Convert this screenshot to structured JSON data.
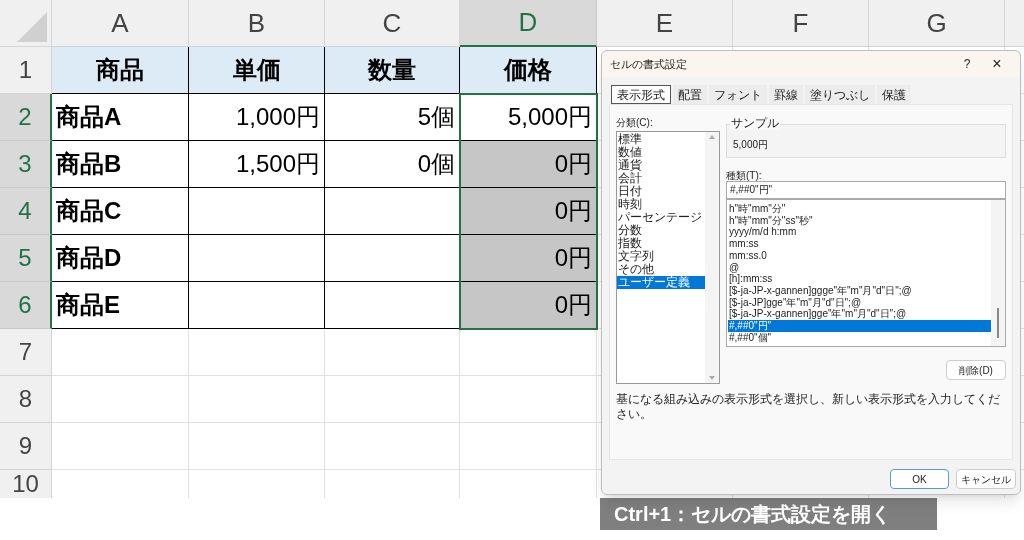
{
  "sheet": {
    "columns": [
      {
        "label": "A",
        "selected": false
      },
      {
        "label": "B",
        "selected": false
      },
      {
        "label": "C",
        "selected": false
      },
      {
        "label": "D",
        "selected": true
      },
      {
        "label": "E",
        "selected": false
      },
      {
        "label": "F",
        "selected": false
      },
      {
        "label": "G",
        "selected": false
      }
    ],
    "rows": [
      {
        "number": "1",
        "selected": false,
        "cells": [
          {
            "kind": "header",
            "text": "商品",
            "selected": false
          },
          {
            "kind": "header",
            "text": "単価",
            "selected": false
          },
          {
            "kind": "header",
            "text": "数量",
            "selected": false
          },
          {
            "kind": "header",
            "text": "価格",
            "selected": false
          }
        ]
      },
      {
        "number": "2",
        "selected": true,
        "cells": [
          {
            "kind": "name",
            "text": "商品A",
            "selected": false
          },
          {
            "kind": "number",
            "text": "1,000円",
            "selected": false
          },
          {
            "kind": "number",
            "text": "5個",
            "selected": false
          },
          {
            "kind": "number",
            "text": "5,000円",
            "selected": false
          }
        ]
      },
      {
        "number": "3",
        "selected": true,
        "cells": [
          {
            "kind": "name",
            "text": "商品B",
            "selected": false
          },
          {
            "kind": "number",
            "text": "1,500円",
            "selected": false
          },
          {
            "kind": "number",
            "text": "0個",
            "selected": false
          },
          {
            "kind": "number",
            "text": "0円",
            "selected": true
          }
        ]
      },
      {
        "number": "4",
        "selected": true,
        "cells": [
          {
            "kind": "name",
            "text": "商品C",
            "selected": false
          },
          {
            "kind": "number",
            "selected": false
          },
          {
            "kind": "number",
            "selected": false
          },
          {
            "kind": "number",
            "text": "0円",
            "selected": true
          }
        ]
      },
      {
        "number": "5",
        "selected": true,
        "cells": [
          {
            "kind": "name",
            "text": "商品D",
            "selected": false
          },
          {
            "kind": "number",
            "selected": false
          },
          {
            "kind": "number",
            "selected": false
          },
          {
            "kind": "number",
            "text": "0円",
            "selected": true
          }
        ]
      },
      {
        "number": "6",
        "selected": true,
        "cells": [
          {
            "kind": "name",
            "text": "商品E",
            "selected": false
          },
          {
            "kind": "number",
            "selected": false
          },
          {
            "kind": "number",
            "selected": false
          },
          {
            "kind": "number",
            "text": "0円",
            "selected": true
          }
        ]
      },
      {
        "number": "7",
        "selected": false
      },
      {
        "number": "8",
        "selected": false
      },
      {
        "number": "9",
        "selected": false
      },
      {
        "number": "10",
        "selected": false
      }
    ]
  },
  "dialog": {
    "title": "セルの書式設定",
    "help": "?",
    "close": "×",
    "tabs": [
      {
        "label": "表示形式",
        "selected": true
      },
      {
        "label": "配置",
        "selected": false
      },
      {
        "label": "フォント",
        "selected": false
      },
      {
        "label": "罫線",
        "selected": false
      },
      {
        "label": "塗りつぶし",
        "selected": false
      },
      {
        "label": "保護",
        "selected": false
      }
    ],
    "category_label": "分類(C):",
    "categories": [
      {
        "label": "標準",
        "selected": false
      },
      {
        "label": "数値",
        "selected": false
      },
      {
        "label": "通貨",
        "selected": false
      },
      {
        "label": "会計",
        "selected": false
      },
      {
        "label": "日付",
        "selected": false
      },
      {
        "label": "時刻",
        "selected": false
      },
      {
        "label": "パーセンテージ",
        "selected": false
      },
      {
        "label": "分数",
        "selected": false
      },
      {
        "label": "指数",
        "selected": false
      },
      {
        "label": "文字列",
        "selected": false
      },
      {
        "label": "その他",
        "selected": false
      },
      {
        "label": "ユーザー定義",
        "selected": true
      }
    ],
    "sample_label": "サンプル",
    "sample_value": "5,000円",
    "type_label": "種類(T):",
    "type_value": "#,##0\"円\"",
    "formats": [
      {
        "label": "h\"時\"mm\"分\"",
        "selected": false
      },
      {
        "label": "h\"時\"mm\"分\"ss\"秒\"",
        "selected": false
      },
      {
        "label": "yyyy/m/d h:mm",
        "selected": false
      },
      {
        "label": "mm:ss",
        "selected": false
      },
      {
        "label": "mm:ss.0",
        "selected": false
      },
      {
        "label": "@",
        "selected": false
      },
      {
        "label": "[h]:mm:ss",
        "selected": false
      },
      {
        "label": "[$-ja-JP-x-gannen]ggge\"年\"m\"月\"d\"日\";@",
        "selected": false
      },
      {
        "label": "[$-ja-JP]gge\"年\"m\"月\"d\"日\";@",
        "selected": false
      },
      {
        "label": "[$-ja-JP-x-gannen]gge\"年\"m\"月\"d\"日\";@",
        "selected": false
      },
      {
        "label": "#,##0\"円\"",
        "selected": true
      },
      {
        "label": "#,##0\"個\"",
        "selected": false
      }
    ],
    "delete_button": "削除(D)",
    "description": "基になる組み込みの表示形式を選択し、新しい表示形式を入力してください。",
    "ok_button": "OK",
    "cancel_button": "キャンセル"
  },
  "caption": "Ctrl+1：セルの書式設定を開く"
}
